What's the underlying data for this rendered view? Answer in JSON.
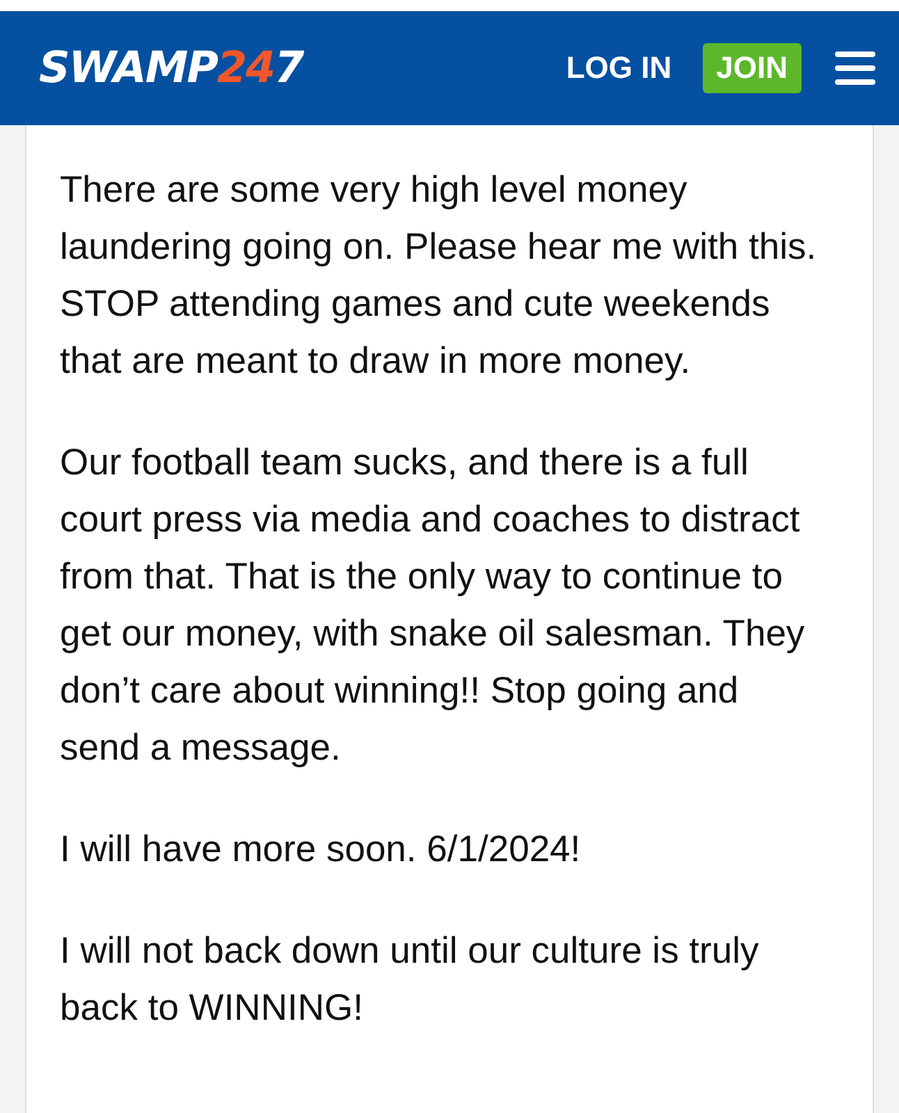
{
  "header": {
    "logo": [
      {
        "text": "SWAMP",
        "color": "#ffffff"
      },
      {
        "text": "24",
        "color": "#f2572b"
      },
      {
        "text": "7",
        "color": "#ffffff"
      }
    ],
    "login": "LOG IN",
    "join": "JOIN"
  },
  "post": {
    "paragraphs": [
      "There are some very high level money laundering going on. Please hear me with this. STOP attending games and cute weekends that are meant to draw in more money.",
      "Our football team sucks, and there is a full court press via media and coaches to distract from that. That is the only way to continue to get our money, with snake oil salesman. They don’t care about winning!! Stop going and send a message.",
      "I will have more soon. 6/1/2024!",
      "I will not back down until our culture is truly back to WINNING!"
    ]
  }
}
